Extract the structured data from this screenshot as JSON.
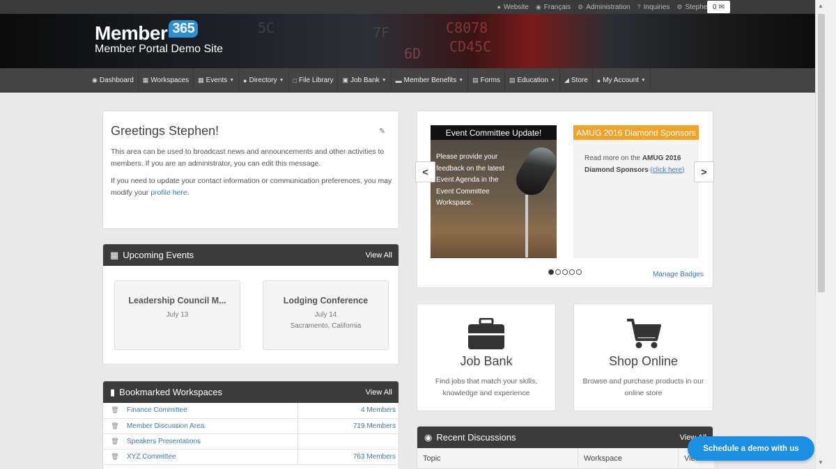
{
  "topbar": {
    "links": [
      {
        "label": "Website",
        "icon": "user-icon"
      },
      {
        "label": "Français",
        "icon": "globe-icon"
      },
      {
        "label": "Administration",
        "icon": "gear-icon"
      },
      {
        "label": "Inquiries",
        "icon": "question-icon"
      },
      {
        "label": "Stephen Foley",
        "icon": "gear-icon"
      }
    ],
    "cart_count": "0"
  },
  "logo": {
    "brand": "Member",
    "number": "365",
    "subtitle": "Member Portal Demo Site"
  },
  "nav": {
    "items": [
      {
        "label": "Dashboard",
        "icon": "dashboard-icon",
        "dropdown": false
      },
      {
        "label": "Workspaces",
        "icon": "grid-icon",
        "dropdown": false
      },
      {
        "label": "Events",
        "icon": "calendar-icon",
        "dropdown": true
      },
      {
        "label": "Directory",
        "icon": "users-icon",
        "dropdown": true
      },
      {
        "label": "File Library",
        "icon": "file-icon",
        "dropdown": false
      },
      {
        "label": "Job Bank",
        "icon": "briefcase-icon",
        "dropdown": true
      },
      {
        "label": "Member Benefits",
        "icon": "card-icon",
        "dropdown": true
      },
      {
        "label": "Forms",
        "icon": "book-icon",
        "dropdown": false
      },
      {
        "label": "Education",
        "icon": "book-icon",
        "dropdown": true
      },
      {
        "label": "Store",
        "icon": "cart-icon",
        "dropdown": false
      },
      {
        "label": "My Account",
        "icon": "user-icon",
        "dropdown": true
      }
    ]
  },
  "greeting": {
    "title": "Greetings Stephen!",
    "para1": "This area can be used to broadcast news and announcements and other activities to members.  If you are an administrator, you can edit this message.",
    "para2_prefix": "If you need to update your contact information or communication preferences, you may modify your ",
    "para2_link": "profile here",
    "para2_suffix": "."
  },
  "events": {
    "title": "Upcoming Events",
    "view_all": "View All",
    "cards": [
      {
        "title": "Leadership Council M...",
        "date": "July 13",
        "location": ""
      },
      {
        "title": "Lodging Conference",
        "date": "July 14",
        "location": "Sacramento, California"
      }
    ]
  },
  "workspaces": {
    "title": "Bookmarked Workspaces",
    "view_all": "View All",
    "rows": [
      {
        "name": "Finance Committee",
        "members": "4 Members"
      },
      {
        "name": "Member Discussion Area",
        "members": "719 Members"
      },
      {
        "name": "Speakers Presentations",
        "members": ""
      },
      {
        "name": "XYZ Committee",
        "members": "763 Members"
      }
    ]
  },
  "carousel": {
    "slide1": {
      "title": "Event Committee Update!",
      "text": "Please provide your feedback on the latest Event Agenda in the Event Committee Workspace."
    },
    "slide2": {
      "title": "AMUG 2016 Diamond Sponsors",
      "text_prefix": "Read more on the ",
      "text_bold": "AMUG 2016 Diamond Sponsors",
      "text_link": "(click here)"
    },
    "prev": "<",
    "next": ">",
    "manage": "Manage Badges",
    "dot_count": 5,
    "active_dot": 0
  },
  "jobbank": {
    "title": "Job Bank",
    "desc": "Find jobs that match your skills, knowledge and experience"
  },
  "shop": {
    "title": "Shop Online",
    "desc": "Browse and purchase products in our online store"
  },
  "discussions": {
    "title": "Recent Discussions",
    "view_all": "View All",
    "columns": [
      "Topic",
      "Workspace",
      "Views"
    ]
  },
  "schedule_button": "Schedule a demo with us"
}
